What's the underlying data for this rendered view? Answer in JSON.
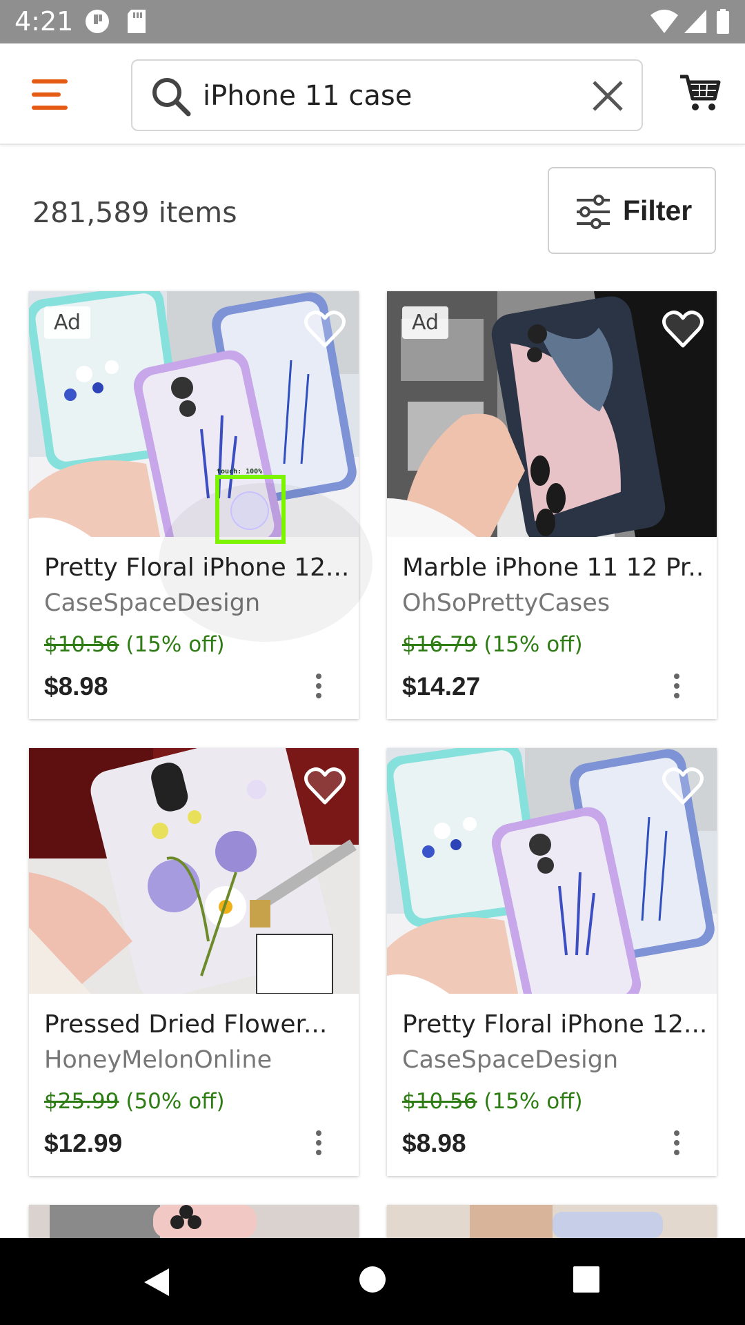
{
  "status_bar": {
    "time": "4:21",
    "icons": [
      "notification-icon",
      "sd-card-icon",
      "wifi-icon",
      "signal-icon",
      "battery-icon"
    ]
  },
  "header": {
    "menu_icon": "hamburger-menu-icon",
    "search": {
      "value": "iPhone 11 case",
      "icon": "search-icon",
      "clear_icon": "close-icon"
    },
    "cart_icon": "cart-icon",
    "accent_color": "#e55b13"
  },
  "results": {
    "count_text": "281,589 items",
    "filter_label": "Filter"
  },
  "products": [
    {
      "ad": "Ad",
      "title": "Pretty Floral iPhone 12...",
      "shop": "CaseSpaceDesign",
      "original_price": "$10.56",
      "discount": "(15% off)",
      "price": "$8.98"
    },
    {
      "ad": "Ad",
      "title": "Marble iPhone 11 12 Pr...",
      "shop": "OhSoPrettyCases",
      "original_price": "$16.79",
      "discount": "(15% off)",
      "price": "$14.27"
    },
    {
      "ad": "",
      "title": "Pressed Dried Flower...",
      "shop": "HoneyMelonOnline",
      "original_price": "$25.99",
      "discount": "(50% off)",
      "price": "$12.99"
    },
    {
      "ad": "",
      "title": "Pretty Floral iPhone 12...",
      "shop": "CaseSpaceDesign",
      "original_price": "$10.56",
      "discount": "(15% off)",
      "price": "$8.98"
    }
  ],
  "touch_indicator": {
    "label": "touch: 100%"
  },
  "colors": {
    "discount_green": "#2e7d14",
    "status_bar_bg": "#8f8f8f"
  }
}
